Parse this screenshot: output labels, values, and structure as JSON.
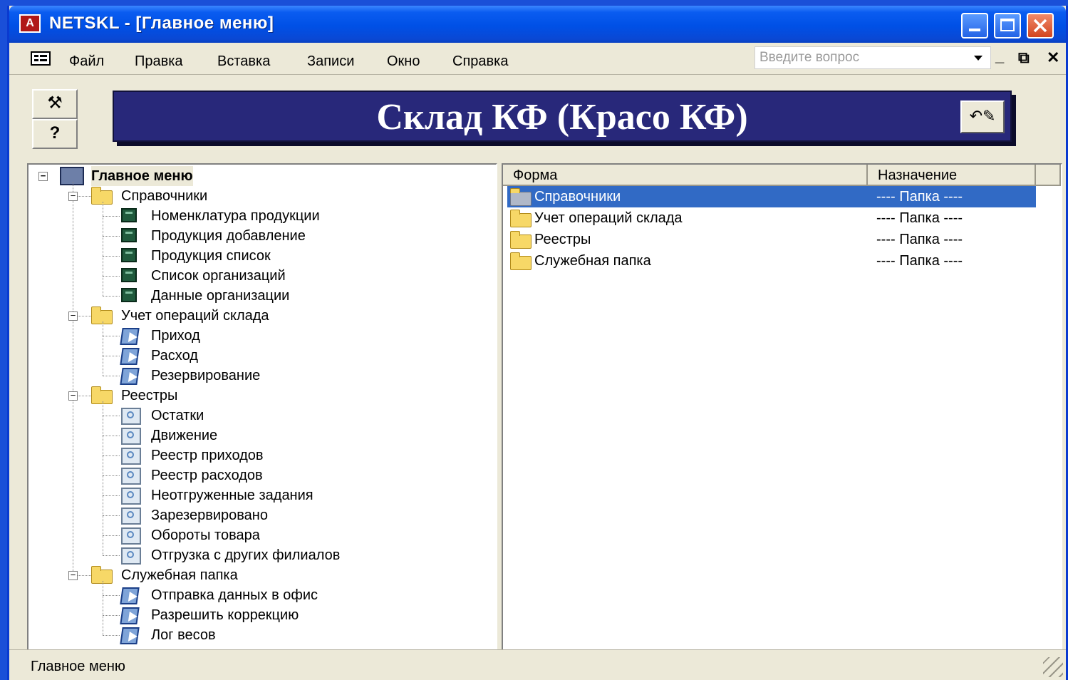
{
  "window": {
    "title": "NETSKL - [Главное меню]",
    "app_icon_letter": "A"
  },
  "menu": {
    "items": [
      "Файл",
      "Правка",
      "Вставка",
      "Записи",
      "Окно",
      "Справка"
    ],
    "search_placeholder": "Введите вопрос"
  },
  "banner": {
    "title": "Склад КФ (Красо КФ)"
  },
  "tree": {
    "root": "Главное меню",
    "groups": [
      {
        "label": "Справочники",
        "items": [
          "Номенклатура продукции",
          "Продукция добавление",
          "Продукция список",
          "Список организаций",
          "Данные организации"
        ],
        "item_icon": "form-icon"
      },
      {
        "label": "Учет операций склада",
        "items": [
          "Приход",
          "Расход",
          "Резервирование"
        ],
        "item_icon": "macro-icon"
      },
      {
        "label": "Реестры",
        "items": [
          "Остатки",
          "Движение",
          "Реестр приходов",
          "Реестр расходов",
          "Неотгруженные задания",
          "Зарезервировано",
          "Обороты товара",
          "Отгрузка с других филиалов"
        ],
        "item_icon": "report-icon"
      },
      {
        "label": "Служебная папка",
        "items": [
          "Отправка данных в офис",
          "Разрешить коррекцию",
          "Лог весов"
        ],
        "item_icon": "macro-icon"
      }
    ]
  },
  "list": {
    "columns": [
      "Форма",
      "Назначение"
    ],
    "rows": [
      {
        "name": "Справочники",
        "purpose": "---- Папка ----",
        "selected": true
      },
      {
        "name": "Учет операций склада",
        "purpose": "---- Папка ----",
        "selected": false
      },
      {
        "name": "Реестры",
        "purpose": "---- Папка ----",
        "selected": false
      },
      {
        "name": "Служебная папка",
        "purpose": "---- Папка ----",
        "selected": false
      }
    ]
  },
  "status": {
    "text": "Главное меню"
  },
  "colors": {
    "title_bar": "#0050e6",
    "banner_bg": "#28287a",
    "selection": "#316ac5"
  }
}
